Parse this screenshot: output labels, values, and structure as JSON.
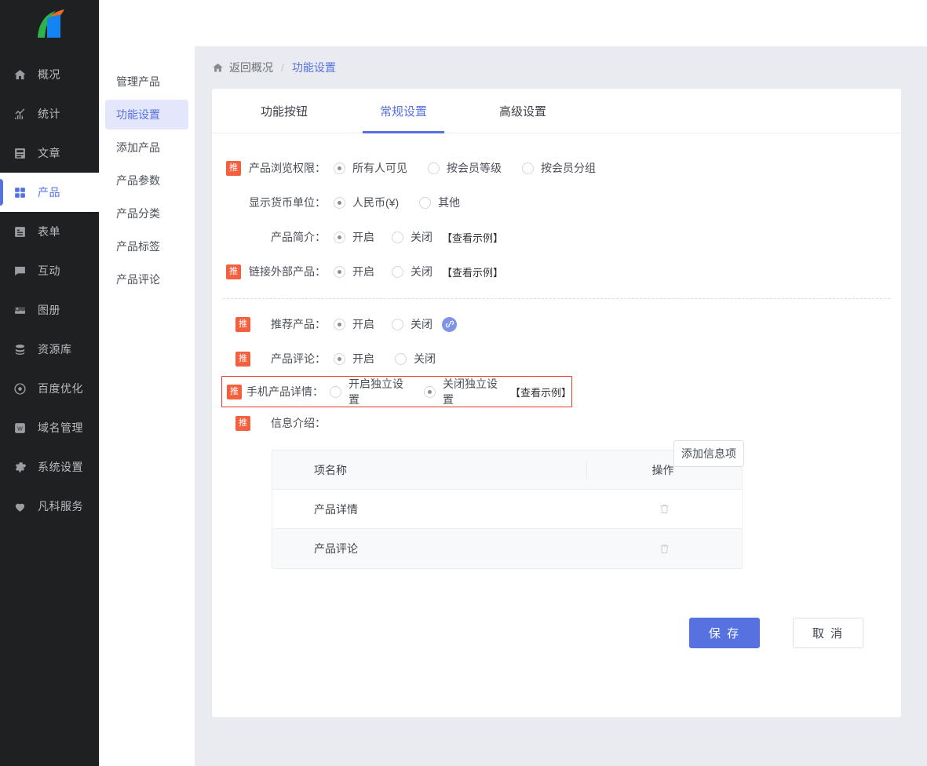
{
  "colors": {
    "accent": "#5572e0",
    "badge": "#f4603e",
    "highlight_border": "#ee3c2a",
    "sidebar_bg": "#1e2022",
    "page_bg": "#e9ebf0"
  },
  "sidebar": {
    "logo_name": "fankeyun-logo",
    "items": [
      {
        "label": "概况",
        "icon": "home-icon",
        "active": false
      },
      {
        "label": "统计",
        "icon": "chart-icon",
        "active": false
      },
      {
        "label": "文章",
        "icon": "article-icon",
        "active": false
      },
      {
        "label": "产品",
        "icon": "grid-icon",
        "active": true
      },
      {
        "label": "表单",
        "icon": "form-icon",
        "active": false
      },
      {
        "label": "互动",
        "icon": "chat-icon",
        "active": false
      },
      {
        "label": "图册",
        "icon": "image-icon",
        "active": false
      },
      {
        "label": "资源库",
        "icon": "database-icon",
        "active": false
      },
      {
        "label": "百度优化",
        "icon": "target-icon",
        "active": false
      },
      {
        "label": "域名管理",
        "icon": "w-square-icon",
        "active": false
      },
      {
        "label": "系统设置",
        "icon": "gear-icon",
        "active": false
      },
      {
        "label": "凡科服务",
        "icon": "heart-icon",
        "active": false
      }
    ]
  },
  "subnav": {
    "items": [
      {
        "label": "管理产品",
        "active": false
      },
      {
        "label": "功能设置",
        "active": true
      },
      {
        "label": "添加产品",
        "active": false
      },
      {
        "label": "产品参数",
        "active": false
      },
      {
        "label": "产品分类",
        "active": false
      },
      {
        "label": "产品标签",
        "active": false
      },
      {
        "label": "产品评论",
        "active": false
      }
    ]
  },
  "breadcrumb": {
    "home_icon": "home-icon",
    "back_label": "返回概况",
    "separator": "/",
    "current": "功能设置"
  },
  "tabs": [
    {
      "label": "功能按钮",
      "active": false
    },
    {
      "label": "常规设置",
      "active": true
    },
    {
      "label": "高级设置",
      "active": false
    }
  ],
  "form": {
    "badge_text": "推",
    "group1": [
      {
        "badge": true,
        "label": "产品浏览权限：",
        "options": [
          {
            "text": "所有人可见",
            "checked": true
          },
          {
            "text": "按会员等级",
            "checked": false
          },
          {
            "text": "按会员分组",
            "checked": false
          }
        ],
        "example": "",
        "link_icon": false
      },
      {
        "badge": false,
        "label": "显示货币单位：",
        "options": [
          {
            "text": "人民币(¥)",
            "checked": true
          },
          {
            "text": "其他",
            "checked": false
          }
        ],
        "example": "",
        "link_icon": false
      },
      {
        "badge": false,
        "label": "产品简介：",
        "options": [
          {
            "text": "开启",
            "checked": true
          },
          {
            "text": "关闭",
            "checked": false
          }
        ],
        "example": "【查看示例】",
        "link_icon": false
      },
      {
        "badge": true,
        "label": "链接外部产品：",
        "options": [
          {
            "text": "开启",
            "checked": true
          },
          {
            "text": "关闭",
            "checked": false
          }
        ],
        "example": "【查看示例】",
        "link_icon": false
      }
    ],
    "group2": [
      {
        "badge": true,
        "label": "推荐产品：",
        "options": [
          {
            "text": "开启",
            "checked": true
          },
          {
            "text": "关闭",
            "checked": false
          }
        ],
        "example": "",
        "link_icon": true
      },
      {
        "badge": true,
        "label": "产品评论：",
        "options": [
          {
            "text": "开启",
            "checked": true
          },
          {
            "text": "关闭",
            "checked": false
          }
        ],
        "example": "",
        "link_icon": false
      }
    ],
    "highlighted_row": {
      "badge": true,
      "label": "手机产品详情：",
      "options": [
        {
          "text": "开启独立设置",
          "checked": false
        },
        {
          "text": "关闭独立设置",
          "checked": true
        }
      ],
      "example": "【查看示例】"
    },
    "info_row": {
      "badge": true,
      "label": "信息介绍："
    }
  },
  "info_table": {
    "add_button": "添加信息项",
    "columns": [
      "项名称",
      "操作"
    ],
    "rows": [
      {
        "name": "产品详情",
        "action_icon": "trash-icon"
      },
      {
        "name": "产品评论",
        "action_icon": "trash-icon"
      }
    ]
  },
  "footer": {
    "save_label": "保 存",
    "cancel_label": "取 消"
  }
}
